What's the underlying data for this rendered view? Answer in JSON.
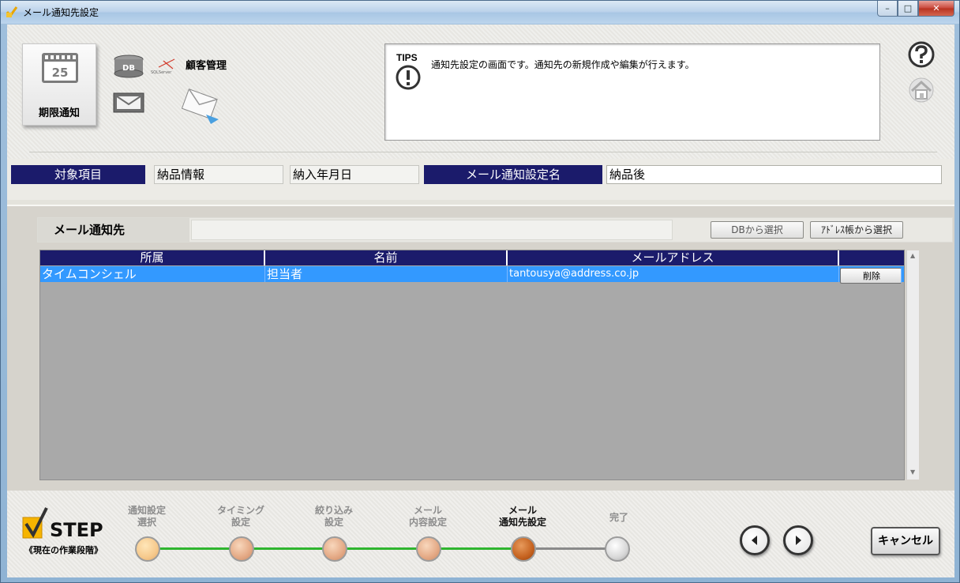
{
  "window": {
    "title": "メール通知先設定",
    "buttons": {
      "minimize": "–",
      "maximize": "□",
      "close": "✕"
    }
  },
  "header": {
    "tile_label": "期限通知",
    "calendar_day": "25",
    "db_label": "DB",
    "sqlserver_label": "SQLServer",
    "kokyaku": "顧客管理"
  },
  "tips": {
    "label": "TIPS",
    "text": "通知先設定の画面です。通知先の新規作成や編集が行えます。"
  },
  "fields": {
    "target_label": "対象項目",
    "target_value1": "納品情報",
    "target_value2": "納入年月日",
    "setting_name_label": "メール通知設定名",
    "setting_name_value": "納品後"
  },
  "notify": {
    "label": "メール通知先",
    "db_select": "DBから選択",
    "address_select": "ｱﾄﾞﾚｽ帳から選択"
  },
  "grid": {
    "columns": [
      "所属",
      "名前",
      "メールアドレス",
      ""
    ],
    "rows": [
      {
        "affiliation": "タイムコンシェル",
        "name": "担当者",
        "email": "tantousya@address.co.jp",
        "action": "削除"
      }
    ]
  },
  "footer": {
    "step_title": "STEP",
    "step_sub": "《現在の作業段階》",
    "steps": [
      {
        "label_line1": "通知設定",
        "label_line2": "選択",
        "state": "done"
      },
      {
        "label_line1": "タイミング",
        "label_line2": "設定",
        "state": "done"
      },
      {
        "label_line1": "絞り込み",
        "label_line2": "設定",
        "state": "done"
      },
      {
        "label_line1": "メール",
        "label_line2": "内容設定",
        "state": "done"
      },
      {
        "label_line1": "メール",
        "label_line2": "通知先設定",
        "state": "current"
      },
      {
        "label_line1": "完了",
        "label_line2": "",
        "state": "todo"
      }
    ],
    "cancel": "キャンセル"
  },
  "colors": {
    "navy": "#1b1b6b",
    "selection": "#3399ff",
    "track_done": "#2fb52f",
    "track_todo": "#8a8a8a"
  }
}
